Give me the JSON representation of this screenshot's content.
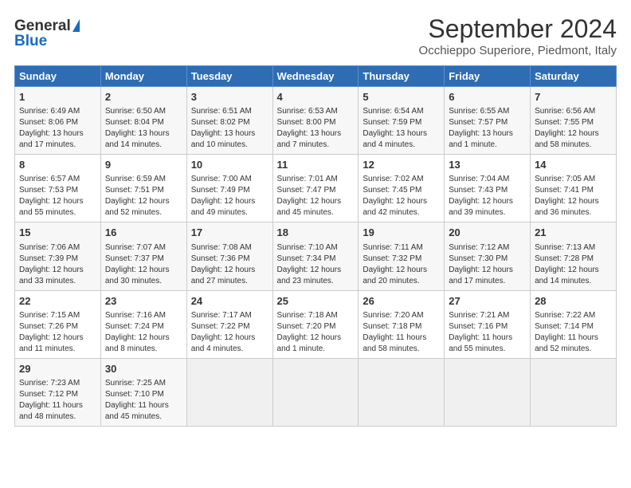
{
  "logo": {
    "general": "General",
    "blue": "Blue"
  },
  "title": "September 2024",
  "location": "Occhieppo Superiore, Piedmont, Italy",
  "days_of_week": [
    "Sunday",
    "Monday",
    "Tuesday",
    "Wednesday",
    "Thursday",
    "Friday",
    "Saturday"
  ],
  "cells": [
    {
      "day": "",
      "content": ""
    },
    {
      "day": "",
      "content": ""
    },
    {
      "day": "",
      "content": ""
    },
    {
      "day": "",
      "content": ""
    },
    {
      "day": "",
      "content": ""
    },
    {
      "day": "",
      "content": ""
    },
    {
      "day": "7",
      "content": "Sunrise: 6:56 AM\nSunset: 7:55 PM\nDaylight: 12 hours and 58 minutes."
    },
    {
      "day": "1",
      "content": "Sunrise: 6:49 AM\nSunset: 8:06 PM\nDaylight: 13 hours and 17 minutes."
    },
    {
      "day": "2",
      "content": "Sunrise: 6:50 AM\nSunset: 8:04 PM\nDaylight: 13 hours and 14 minutes."
    },
    {
      "day": "3",
      "content": "Sunrise: 6:51 AM\nSunset: 8:02 PM\nDaylight: 13 hours and 10 minutes."
    },
    {
      "day": "4",
      "content": "Sunrise: 6:53 AM\nSunset: 8:00 PM\nDaylight: 13 hours and 7 minutes."
    },
    {
      "day": "5",
      "content": "Sunrise: 6:54 AM\nSunset: 7:59 PM\nDaylight: 13 hours and 4 minutes."
    },
    {
      "day": "6",
      "content": "Sunrise: 6:55 AM\nSunset: 7:57 PM\nDaylight: 13 hours and 1 minute."
    },
    {
      "day": "7",
      "content": "Sunrise: 6:56 AM\nSunset: 7:55 PM\nDaylight: 12 hours and 58 minutes."
    },
    {
      "day": "8",
      "content": "Sunrise: 6:57 AM\nSunset: 7:53 PM\nDaylight: 12 hours and 55 minutes."
    },
    {
      "day": "9",
      "content": "Sunrise: 6:59 AM\nSunset: 7:51 PM\nDaylight: 12 hours and 52 minutes."
    },
    {
      "day": "10",
      "content": "Sunrise: 7:00 AM\nSunset: 7:49 PM\nDaylight: 12 hours and 49 minutes."
    },
    {
      "day": "11",
      "content": "Sunrise: 7:01 AM\nSunset: 7:47 PM\nDaylight: 12 hours and 45 minutes."
    },
    {
      "day": "12",
      "content": "Sunrise: 7:02 AM\nSunset: 7:45 PM\nDaylight: 12 hours and 42 minutes."
    },
    {
      "day": "13",
      "content": "Sunrise: 7:04 AM\nSunset: 7:43 PM\nDaylight: 12 hours and 39 minutes."
    },
    {
      "day": "14",
      "content": "Sunrise: 7:05 AM\nSunset: 7:41 PM\nDaylight: 12 hours and 36 minutes."
    },
    {
      "day": "15",
      "content": "Sunrise: 7:06 AM\nSunset: 7:39 PM\nDaylight: 12 hours and 33 minutes."
    },
    {
      "day": "16",
      "content": "Sunrise: 7:07 AM\nSunset: 7:37 PM\nDaylight: 12 hours and 30 minutes."
    },
    {
      "day": "17",
      "content": "Sunrise: 7:08 AM\nSunset: 7:36 PM\nDaylight: 12 hours and 27 minutes."
    },
    {
      "day": "18",
      "content": "Sunrise: 7:10 AM\nSunset: 7:34 PM\nDaylight: 12 hours and 23 minutes."
    },
    {
      "day": "19",
      "content": "Sunrise: 7:11 AM\nSunset: 7:32 PM\nDaylight: 12 hours and 20 minutes."
    },
    {
      "day": "20",
      "content": "Sunrise: 7:12 AM\nSunset: 7:30 PM\nDaylight: 12 hours and 17 minutes."
    },
    {
      "day": "21",
      "content": "Sunrise: 7:13 AM\nSunset: 7:28 PM\nDaylight: 12 hours and 14 minutes."
    },
    {
      "day": "22",
      "content": "Sunrise: 7:15 AM\nSunset: 7:26 PM\nDaylight: 12 hours and 11 minutes."
    },
    {
      "day": "23",
      "content": "Sunrise: 7:16 AM\nSunset: 7:24 PM\nDaylight: 12 hours and 8 minutes."
    },
    {
      "day": "24",
      "content": "Sunrise: 7:17 AM\nSunset: 7:22 PM\nDaylight: 12 hours and 4 minutes."
    },
    {
      "day": "25",
      "content": "Sunrise: 7:18 AM\nSunset: 7:20 PM\nDaylight: 12 hours and 1 minute."
    },
    {
      "day": "26",
      "content": "Sunrise: 7:20 AM\nSunset: 7:18 PM\nDaylight: 11 hours and 58 minutes."
    },
    {
      "day": "27",
      "content": "Sunrise: 7:21 AM\nSunset: 7:16 PM\nDaylight: 11 hours and 55 minutes."
    },
    {
      "day": "28",
      "content": "Sunrise: 7:22 AM\nSunset: 7:14 PM\nDaylight: 11 hours and 52 minutes."
    },
    {
      "day": "29",
      "content": "Sunrise: 7:23 AM\nSunset: 7:12 PM\nDaylight: 11 hours and 48 minutes."
    },
    {
      "day": "30",
      "content": "Sunrise: 7:25 AM\nSunset: 7:10 PM\nDaylight: 11 hours and 45 minutes."
    },
    {
      "day": "",
      "content": ""
    },
    {
      "day": "",
      "content": ""
    },
    {
      "day": "",
      "content": ""
    },
    {
      "day": "",
      "content": ""
    },
    {
      "day": "",
      "content": ""
    }
  ]
}
